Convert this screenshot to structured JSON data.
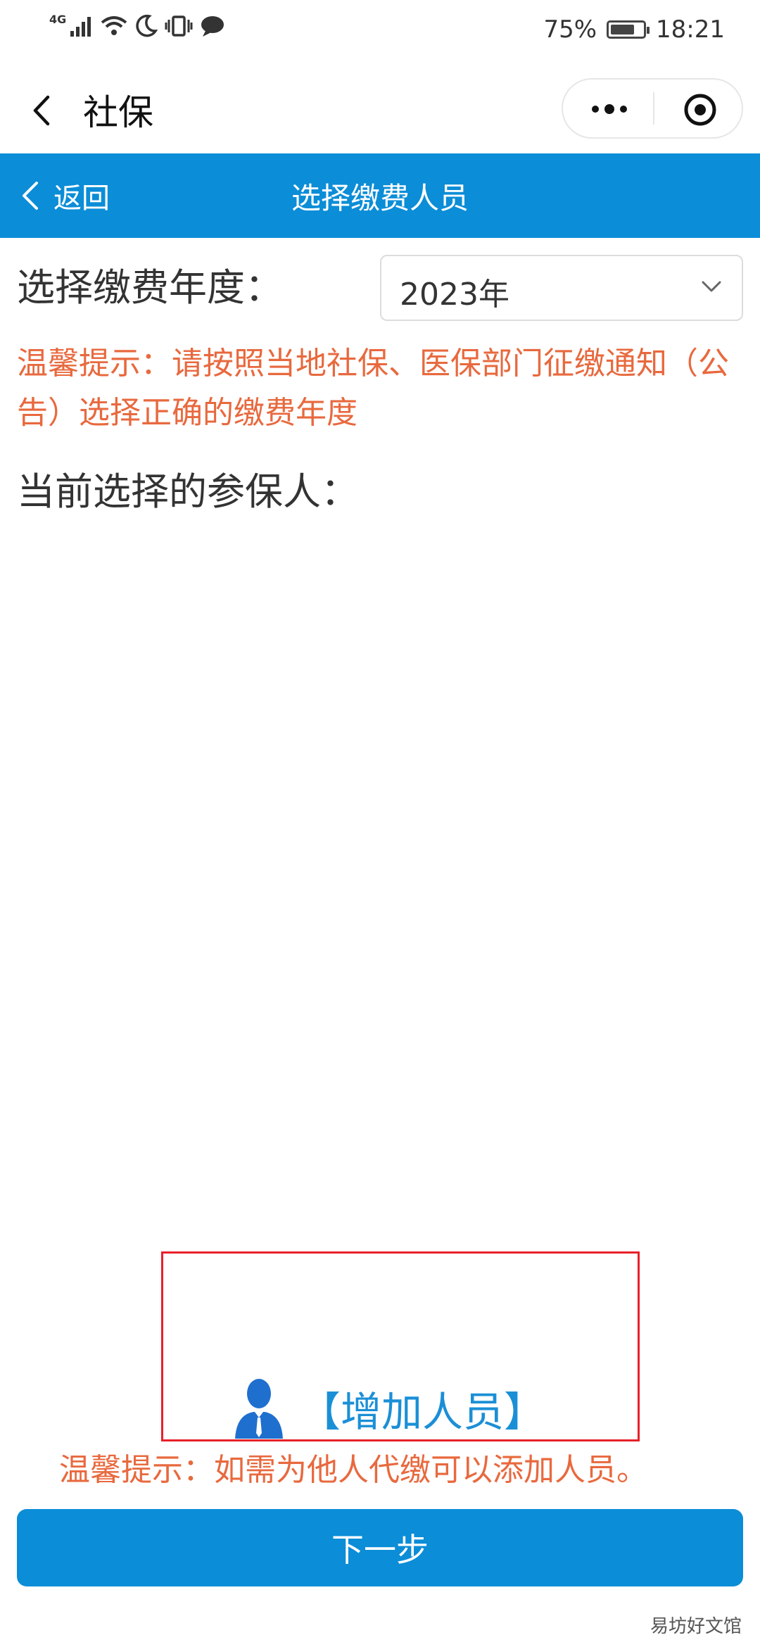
{
  "status_bar": {
    "network": "4G",
    "battery_percent": "75%",
    "battery_level": 0.75,
    "time": "18:21",
    "icons": [
      "signal-icon",
      "wifi-icon",
      "moon-icon",
      "vibrate-icon",
      "chat-bubble-icon"
    ]
  },
  "mini_program": {
    "title": "社保"
  },
  "nav": {
    "back_label": "返回",
    "title": "选择缴费人员"
  },
  "form": {
    "year_label": "选择缴费年度：",
    "year_value": "2023年",
    "tip": "温馨提示：请按照当地社保、医保部门征缴通知（公告）选择正确的缴费年度",
    "current_label": "当前选择的参保人："
  },
  "add_person": {
    "label": "【增加人员】"
  },
  "bottom_tip": "温馨提示：如需为他人代缴可以添加人员。",
  "next_button": "下一步",
  "watermark": "易坊好文馆",
  "colors": {
    "primary_blue": "#0b8dd7",
    "tip_orange": "#e8693e",
    "highlight_red": "#e8202a",
    "link_blue": "#1b8fd6"
  }
}
